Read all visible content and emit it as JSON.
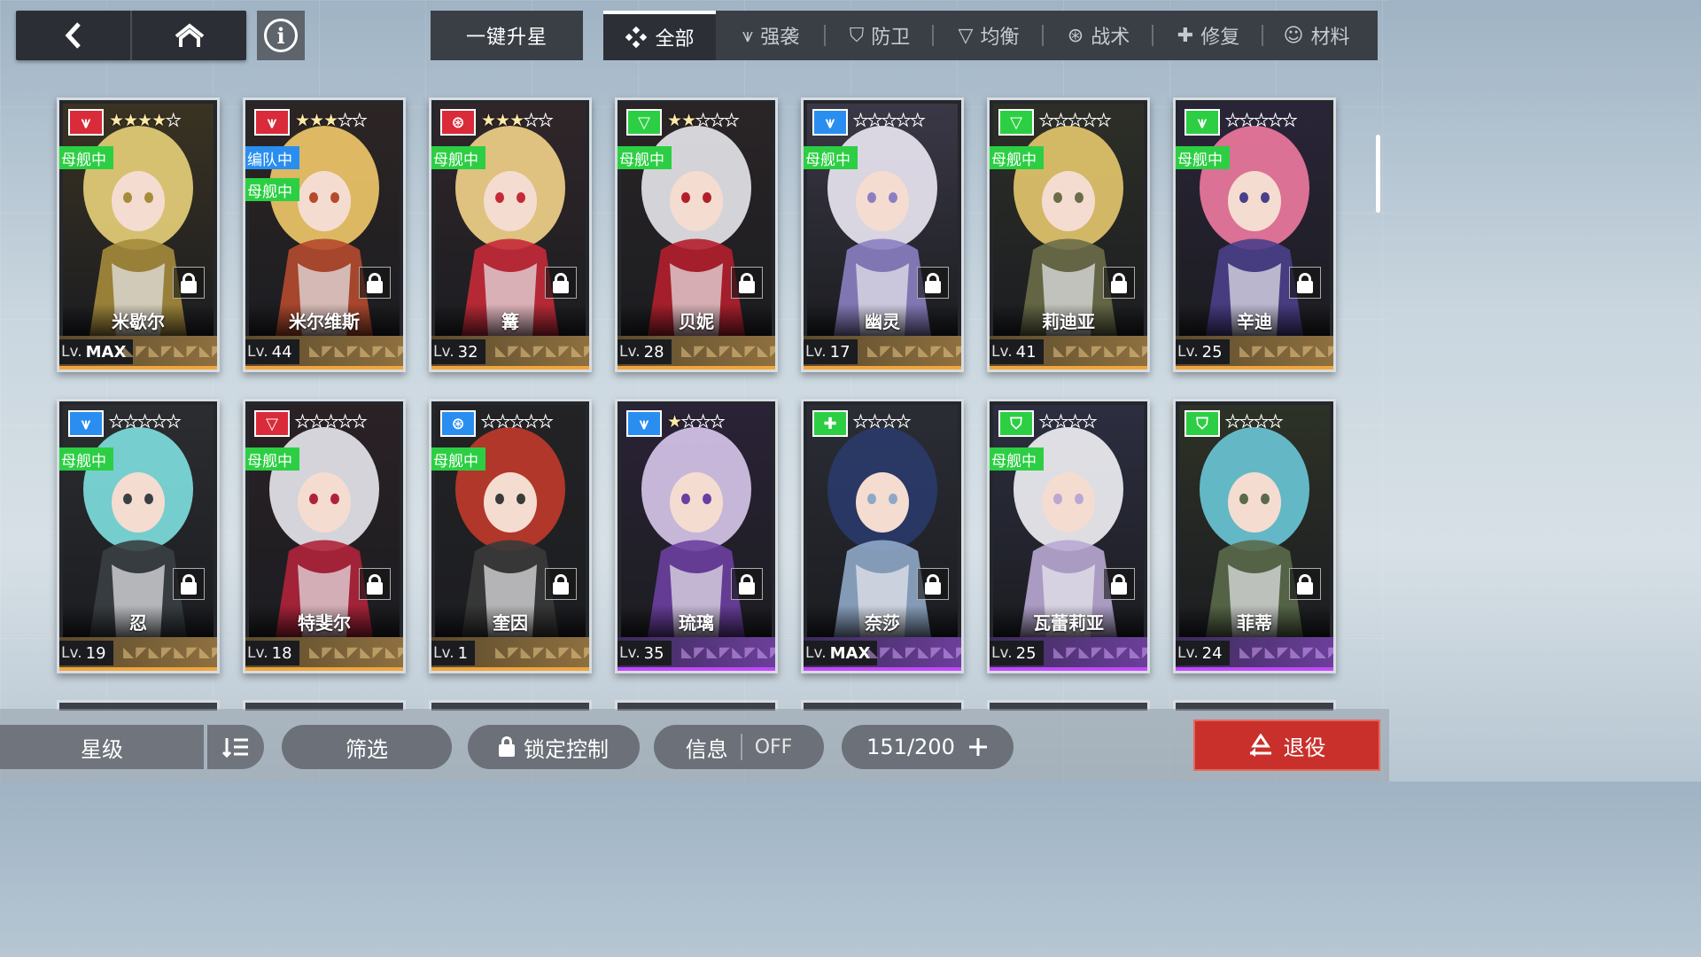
{
  "top_bar": {
    "back_icon": "back-arrow-icon",
    "home_icon": "home-icon",
    "info_icon": "info-icon",
    "info_glyph": "i",
    "upgrade_label": "一键升星",
    "tabs": [
      {
        "label": "全部",
        "icon": "all-icon",
        "active": true
      },
      {
        "label": "强袭",
        "icon": "assault-icon",
        "active": false
      },
      {
        "label": "防卫",
        "icon": "defense-icon",
        "active": false
      },
      {
        "label": "均衡",
        "icon": "balance-icon",
        "active": false
      },
      {
        "label": "战术",
        "icon": "tactics-icon",
        "active": false
      },
      {
        "label": "修复",
        "icon": "repair-icon",
        "active": false
      },
      {
        "label": "材料",
        "icon": "material-icon",
        "active": false
      }
    ]
  },
  "cards": [
    {
      "name": "米歇尔",
      "level": "MAX",
      "stars": 4,
      "max_stars": 5,
      "class": "assault",
      "class_color": "#d92b3a",
      "badges": [
        {
          "text": "母舰中",
          "color": "green"
        }
      ],
      "rarity": "gold"
    },
    {
      "name": "米尔维斯",
      "level": "44",
      "stars": 3,
      "max_stars": 5,
      "class": "assault",
      "class_color": "#d92b3a",
      "badges": [
        {
          "text": "编队中",
          "color": "blue"
        },
        {
          "text": "母舰中",
          "color": "green"
        }
      ],
      "rarity": "gold"
    },
    {
      "name": "篝",
      "level": "32",
      "stars": 3,
      "max_stars": 5,
      "class": "tactics",
      "class_color": "#d92b3a",
      "badges": [
        {
          "text": "母舰中",
          "color": "green"
        }
      ],
      "rarity": "gold"
    },
    {
      "name": "贝妮",
      "level": "28",
      "stars": 2,
      "max_stars": 5,
      "class": "balance",
      "class_color": "#2ccf43",
      "badges": [
        {
          "text": "母舰中",
          "color": "green"
        }
      ],
      "rarity": "gold"
    },
    {
      "name": "幽灵",
      "level": "17",
      "stars": 0,
      "max_stars": 5,
      "class": "assault",
      "class_color": "#2a8ef0",
      "badges": [
        {
          "text": "母舰中",
          "color": "green"
        }
      ],
      "rarity": "gold"
    },
    {
      "name": "莉迪亚",
      "level": "41",
      "stars": 0,
      "max_stars": 5,
      "class": "balance",
      "class_color": "#2ccf43",
      "badges": [
        {
          "text": "母舰中",
          "color": "green"
        }
      ],
      "rarity": "gold"
    },
    {
      "name": "辛迪",
      "level": "25",
      "stars": 0,
      "max_stars": 5,
      "class": "assault",
      "class_color": "#2ccf43",
      "badges": [
        {
          "text": "母舰中",
          "color": "green"
        }
      ],
      "rarity": "gold"
    },
    {
      "name": "忍",
      "level": "19",
      "stars": 0,
      "max_stars": 5,
      "class": "assault",
      "class_color": "#2a8ef0",
      "badges": [
        {
          "text": "母舰中",
          "color": "green"
        }
      ],
      "rarity": "gold"
    },
    {
      "name": "特斐尔",
      "level": "18",
      "stars": 0,
      "max_stars": 5,
      "class": "balance",
      "class_color": "#d92b3a",
      "badges": [
        {
          "text": "母舰中",
          "color": "green"
        }
      ],
      "rarity": "gold"
    },
    {
      "name": "奎因",
      "level": "1",
      "stars": 0,
      "max_stars": 5,
      "class": "tactics",
      "class_color": "#2a8ef0",
      "badges": [
        {
          "text": "母舰中",
          "color": "green"
        }
      ],
      "rarity": "gold"
    },
    {
      "name": "琉璃",
      "level": "35",
      "stars": 1,
      "max_stars": 4,
      "class": "assault",
      "class_color": "#2a8ef0",
      "badges": [],
      "rarity": "purple"
    },
    {
      "name": "奈莎",
      "level": "MAX",
      "stars": 0,
      "max_stars": 4,
      "class": "repair",
      "class_color": "#2ccf43",
      "badges": [],
      "rarity": "purple"
    },
    {
      "name": "瓦蕾莉亚",
      "level": "25",
      "stars": 0,
      "max_stars": 4,
      "class": "defense",
      "class_color": "#2ccf43",
      "badges": [
        {
          "text": "母舰中",
          "color": "green"
        }
      ],
      "rarity": "purple"
    },
    {
      "name": "菲蒂",
      "level": "24",
      "stars": 0,
      "max_stars": 4,
      "class": "defense",
      "class_color": "#2ccf43",
      "badges": [],
      "rarity": "purple"
    }
  ],
  "level_prefix": "Lv.",
  "bottom_bar": {
    "sort_label": "星级",
    "order_icon": "sort-order-icon",
    "filter_label": "筛选",
    "lock_label": "锁定控制",
    "info_label": "信息",
    "info_state": "OFF",
    "count": "151/200",
    "expand_icon": "plus-icon",
    "retire_label": "退役",
    "retire_icon": "recycle-icon"
  },
  "colors": {
    "badge_green": "#2ccf43",
    "badge_blue": "#2a8ef0",
    "retire_red": "#c9302b",
    "rarity_gold": "#f1a53c",
    "rarity_purple": "#c347ff"
  }
}
